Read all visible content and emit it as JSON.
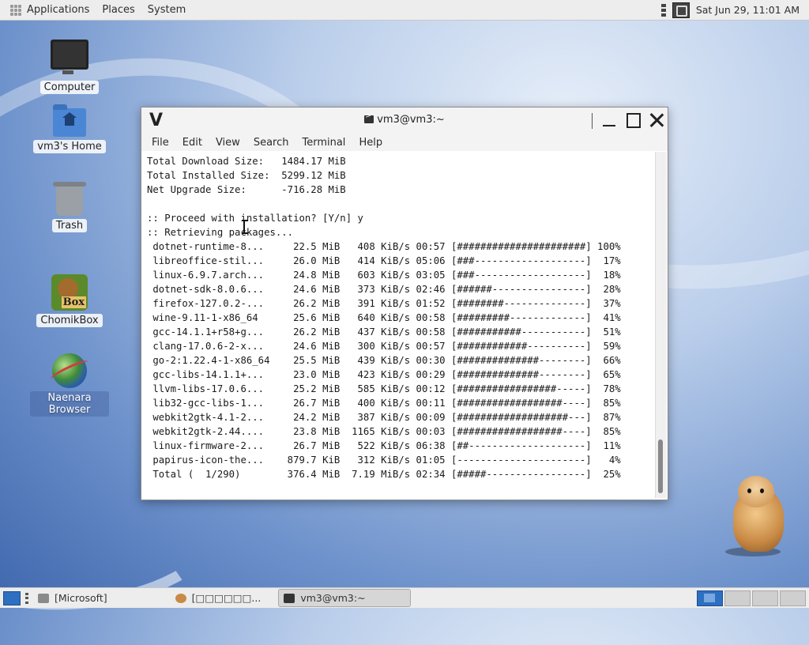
{
  "top_panel": {
    "menus": [
      "Applications",
      "Places",
      "System"
    ],
    "clock": "Sat Jun 29, 11:01 AM"
  },
  "desktop": {
    "icons": [
      {
        "label": "Computer"
      },
      {
        "label": "vm3's Home"
      },
      {
        "label": "Trash"
      },
      {
        "label": "ChomikBox"
      },
      {
        "label": "Naenara Browser"
      }
    ]
  },
  "window": {
    "app_mark": "V",
    "title": "vm3@vm3:~",
    "menus": [
      "File",
      "Edit",
      "View",
      "Search",
      "Terminal",
      "Help"
    ],
    "terminal_lines": [
      "Total Download Size:   1484.17 MiB",
      "Total Installed Size:  5299.12 MiB",
      "Net Upgrade Size:      -716.28 MiB",
      "",
      ":: Proceed with installation? [Y/n] y",
      ":: Retrieving packages...",
      " dotnet-runtime-8...     22.5 MiB   408 KiB/s 00:57 [######################] 100%",
      " libreoffice-stil...     26.0 MiB   414 KiB/s 05:06 [###-------------------]  17%",
      " linux-6.9.7.arch...     24.8 MiB   603 KiB/s 03:05 [###-------------------]  18%",
      " dotnet-sdk-8.0.6...     24.6 MiB   373 KiB/s 02:46 [######----------------]  28%",
      " firefox-127.0.2-...     26.2 MiB   391 KiB/s 01:52 [########--------------]  37%",
      " wine-9.11-1-x86_64      25.6 MiB   640 KiB/s 00:58 [#########-------------]  41%",
      " gcc-14.1.1+r58+g...     26.2 MiB   437 KiB/s 00:58 [###########-----------]  51%",
      " clang-17.0.6-2-x...     24.6 MiB   300 KiB/s 00:57 [############----------]  59%",
      " go-2:1.22.4-1-x86_64    25.5 MiB   439 KiB/s 00:30 [##############--------]  66%",
      " gcc-libs-14.1.1+...     23.0 MiB   423 KiB/s 00:29 [##############--------]  65%",
      " llvm-libs-17.0.6...     25.2 MiB   585 KiB/s 00:12 [#################-----]  78%",
      " lib32-gcc-libs-1...     26.7 MiB   400 KiB/s 00:11 [##################----]  85%",
      " webkit2gtk-4.1-2...     24.2 MiB   387 KiB/s 00:09 [###################---]  87%",
      " webkit2gtk-2.44....     23.8 MiB  1165 KiB/s 00:03 [##################----]  85%",
      " linux-firmware-2...     26.7 MiB   522 KiB/s 06:38 [##--------------------]  11%",
      " papirus-icon-the...    879.7 KiB   312 KiB/s 01:05 [----------------------]   4%",
      " Total (  1/290)        376.4 MiB  7.19 MiB/s 02:34 [#####-----------------]  25%"
    ]
  },
  "bottom_panel": {
    "tasks": [
      "[Microsoft]",
      "[□□□□□□...",
      "vm3@vm3:~"
    ]
  }
}
